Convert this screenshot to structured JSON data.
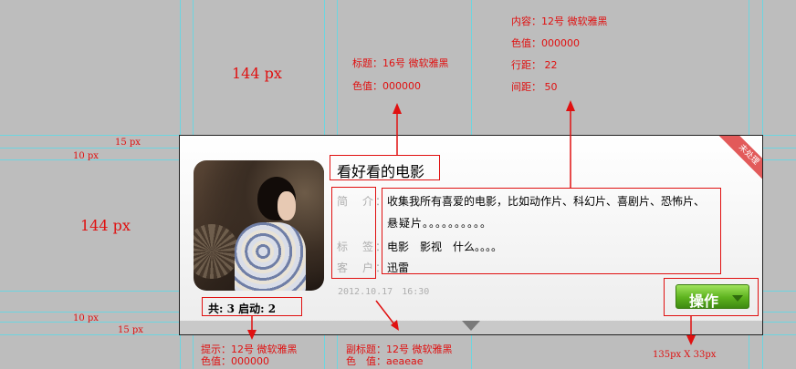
{
  "dimensions": {
    "dim_144_top": "144 px",
    "dim_144_left": "144 px",
    "dim_15_top": "15 px",
    "dim_10_top": "10 px",
    "dim_10_bottom": "10 px",
    "dim_15_bottom": "15 px",
    "button_size": "135px X 33px"
  },
  "annotations": {
    "title_spec": [
      "标题：16号 微软雅黑",
      "色值：000000"
    ],
    "content_spec": [
      "内容：12号 微软雅黑",
      "色值：000000",
      "行距： 22",
      "间距： 50"
    ],
    "hint_spec": [
      "提示：12号 微软雅黑",
      "色值：000000"
    ],
    "subtitle_spec": [
      "副标题：12号 微软雅黑",
      "色　值：aeaeae"
    ]
  },
  "card": {
    "title": "看好看的电影",
    "ribbon": "未处理",
    "rows": [
      {
        "label": "简　介：",
        "value_line1": "收集我所有喜爱的电影，比如动作片、科幻片、喜剧片、恐怖片、",
        "value_line2": "悬疑片。。。。。。。。。。"
      },
      {
        "label": "标　签：",
        "value": "电影　影视　什么。。。。"
      },
      {
        "label": "客　户：",
        "value": "迅雷"
      }
    ],
    "timestamp": "2012.10.17　16:30",
    "stats": "共: 3 启动: 2",
    "action_button": "操作"
  },
  "colors": {
    "annotation_red": "#e01010",
    "guide_cyan": "#5fd9e6",
    "button_green": "#5db21e",
    "ribbon_red": "#e25a5a"
  }
}
